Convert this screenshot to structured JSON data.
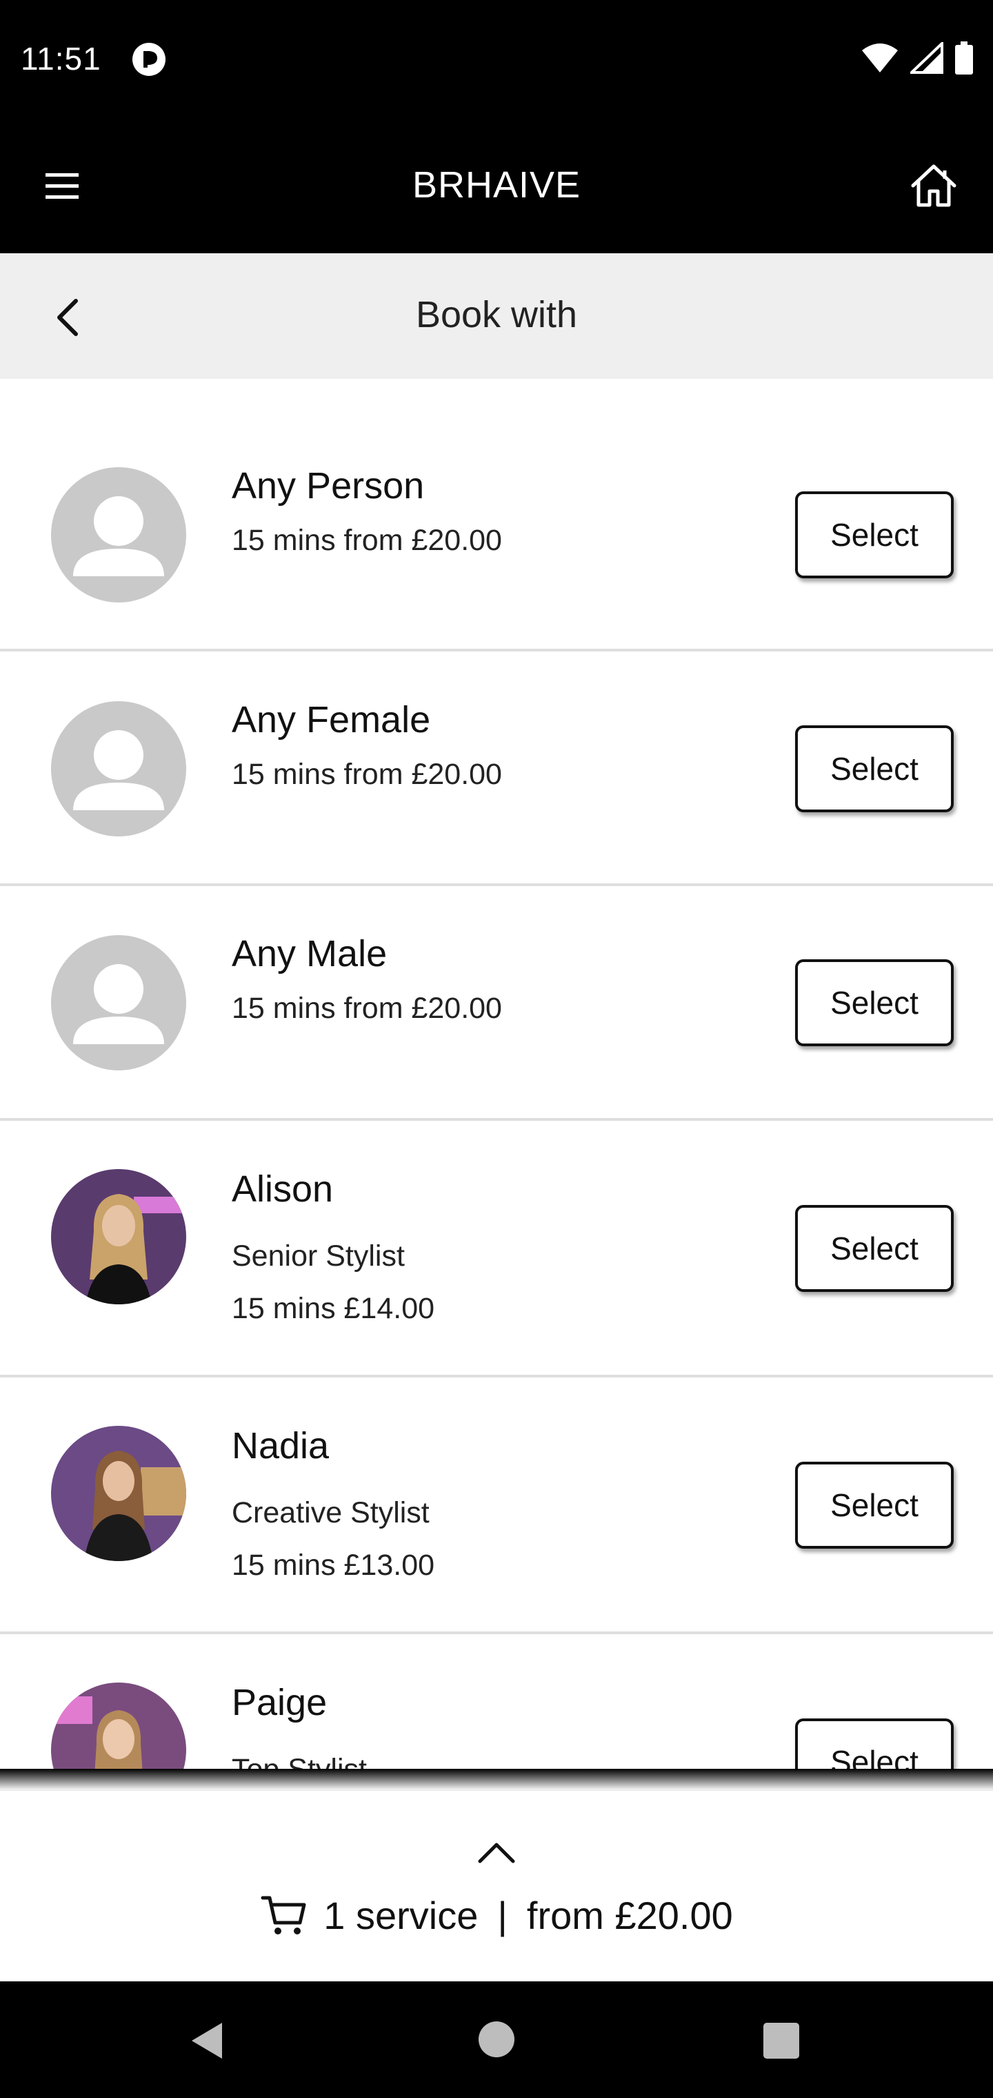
{
  "status_bar": {
    "time": "11:51"
  },
  "app_bar": {
    "title": "BRHAIVE"
  },
  "subheader": {
    "title": "Book with"
  },
  "rows": [
    {
      "name": "Any Person",
      "line1": "15 mins from £20.00",
      "button": "Select"
    },
    {
      "name": "Any Female",
      "line1": "15 mins from £20.00",
      "button": "Select"
    },
    {
      "name": "Any Male",
      "line1": "15 mins from £20.00",
      "button": "Select"
    },
    {
      "name": "Alison",
      "line1": "Senior Stylist",
      "line2": "15 mins £14.00",
      "button": "Select"
    },
    {
      "name": "Nadia",
      "line1": "Creative Stylist",
      "line2": "15 mins £13.00",
      "button": "Select"
    },
    {
      "name": "Paige",
      "line1": "Top Stylist",
      "button": "Select"
    }
  ],
  "cart": {
    "count_text": "1 service",
    "separator": "|",
    "price_text": "from £20.00"
  },
  "icons": {
    "status": [
      "app-notification-icon",
      "wifi-icon",
      "cell-signal-icon",
      "battery-icon"
    ],
    "app_bar": [
      "menu-icon",
      "home-icon"
    ],
    "subheader": [
      "back-icon"
    ],
    "cart": [
      "chevron-up-icon",
      "cart-icon"
    ],
    "nav": [
      "nav-back-icon",
      "nav-home-icon",
      "nav-recents-icon"
    ]
  },
  "colors": {
    "app_bar": "#000000",
    "subheader_bg": "#efefef",
    "avatar_placeholder": "#c9c9c9",
    "divider": "#dedede"
  }
}
